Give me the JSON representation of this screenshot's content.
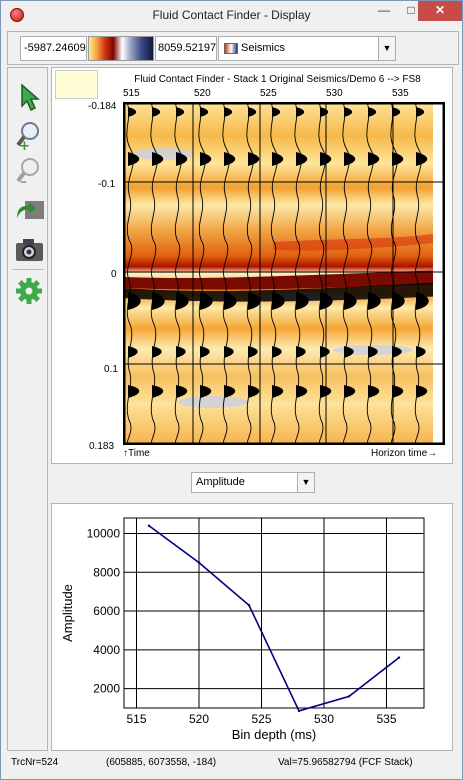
{
  "window": {
    "title": "Fluid Contact Finder - Display"
  },
  "toolbar": {
    "color_min": "-5987.24609",
    "color_max": "8059.521972",
    "attribute": "Seismics"
  },
  "tools": [
    {
      "name": "pointer-arrow-icon",
      "icon": "pointer-arrow"
    },
    {
      "name": "zoom-in-icon",
      "icon": "zoom-in"
    },
    {
      "name": "zoom-out-icon",
      "icon": "zoom-out"
    },
    {
      "name": "reset-view-icon",
      "icon": "reset-view"
    },
    {
      "name": "camera-icon",
      "icon": "camera"
    },
    {
      "name": "settings-gear-icon",
      "icon": "settings-gear"
    }
  ],
  "display": {
    "title": "Fluid Contact Finder - Stack 1 Original Seismics/Demo 6 --> FS8",
    "top_axis_ticks": [
      "515",
      "520",
      "525",
      "530",
      "535"
    ],
    "left_axis_ticks": [
      "-0.184",
      "-0.1",
      "0",
      "0.1",
      "0.183"
    ],
    "bottom_left_label": "↑Time",
    "bottom_right_label": "Horizon time→"
  },
  "attribute_selector": {
    "value": "Amplitude"
  },
  "chart_data": {
    "type": "line",
    "xlabel": "Bin depth (ms)",
    "ylabel": "Amplitude",
    "xlim": [
      514,
      538
    ],
    "ylim": [
      1000,
      10800
    ],
    "x_ticks": [
      515,
      520,
      525,
      530,
      535
    ],
    "y_ticks": [
      2000,
      4000,
      6000,
      8000,
      10000
    ],
    "grid": true,
    "series": [
      {
        "color": "#000080",
        "x": [
          516,
          520,
          524,
          528,
          532,
          536
        ],
        "y": [
          10400,
          8500,
          6300,
          850,
          1600,
          3600
        ]
      }
    ]
  },
  "status": {
    "trace": "TrcNr=524",
    "coords": "(605885, 6073558, -184)",
    "value": "Val=75.96582794 (FCF Stack)"
  }
}
